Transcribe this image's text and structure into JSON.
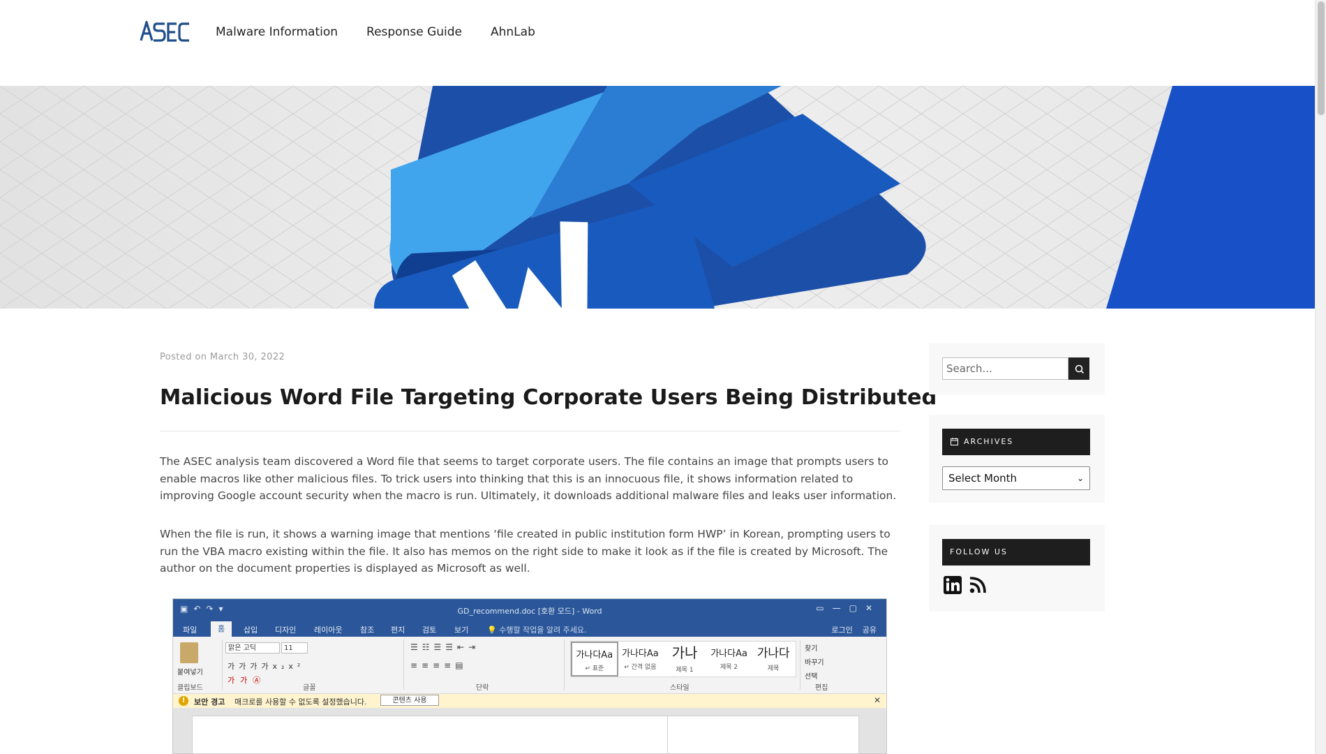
{
  "header": {
    "nav": [
      "Malware Information",
      "Response Guide",
      "AhnLab"
    ]
  },
  "post": {
    "posted_on_label": "Posted on",
    "date": "March 30, 2022",
    "title": "Malicious Word File Targeting Corporate Users Being Distributed",
    "paragraphs": [
      "The ASEC analysis team discovered a Word file that seems to target corporate users. The file contains an image that prompts users to enable macros like other malicious files. To trick users into thinking that this is an innocuous file, it shows information related to improving Google account security when the macro is run. Ultimately, it downloads additional malware files and leaks user information.",
      "When the file is run, it shows a warning image that mentions ‘file created in public institution form HWP’ in Korean, prompting users to run the VBA macro existing within the file. It also has memos on the right side to make it look as if the file is created by Microsoft. The author on the document properties is displayed as Microsoft as well."
    ]
  },
  "word_screenshot": {
    "doc_title": "GD_recommend.doc [호환 모드] - Word",
    "tabs": [
      "파일",
      "홈",
      "삽입",
      "디자인",
      "레이아웃",
      "참조",
      "편지",
      "검토",
      "보기"
    ],
    "tell_me": "수행할 작업을 알려 주세요.",
    "login": "로그인",
    "share": "공유",
    "font_name": "맑은 고딕",
    "font_size": "11",
    "paste_label": "붙여넣기",
    "groups": [
      "클립보드",
      "글꼴",
      "단락",
      "스타일",
      "편집"
    ],
    "styles": [
      {
        "sample": "가나다Aa",
        "name": "↵ 표준"
      },
      {
        "sample": "가나다Aa",
        "name": "↵ 간격 없음"
      },
      {
        "sample": "가나",
        "name": "제목 1"
      },
      {
        "sample": "가나다Aa",
        "name": "제목 2"
      },
      {
        "sample": "가나다",
        "name": "제목"
      }
    ],
    "edit": [
      "찾기",
      "바꾸기",
      "선택"
    ],
    "warning_label": "보안 경고",
    "warning_message": "매크로를 사용할 수 없도록 설정했습니다.",
    "warning_button": "콘텐츠 사용"
  },
  "sidebar": {
    "search_placeholder": "Search...",
    "archives_title": "ARCHIVES",
    "archives_select": "Select Month",
    "follow_title": "FOLLOW US",
    "social_icons": [
      "linkedin-icon",
      "rss-icon"
    ]
  },
  "colors": {
    "word_blue": "#2b579a",
    "hero_blue": "#1850c8",
    "widget_title_bg": "#1e1e1e"
  }
}
